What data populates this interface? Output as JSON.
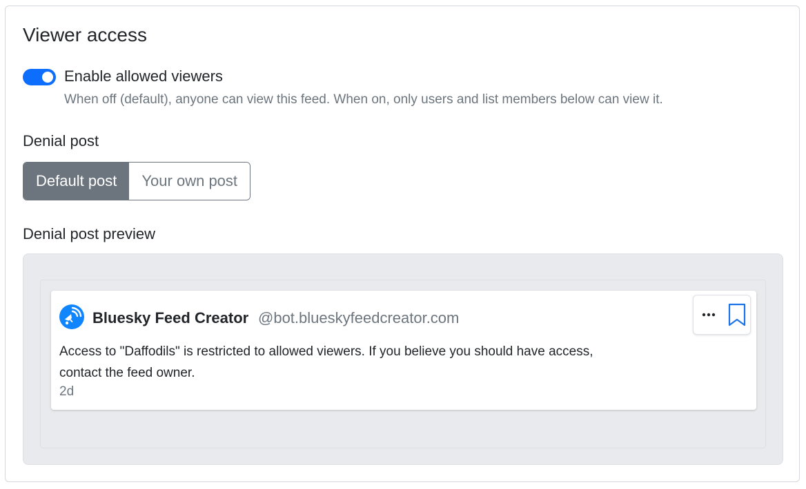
{
  "section": {
    "title": "Viewer access"
  },
  "toggle": {
    "label": "Enable allowed viewers",
    "enabled": true,
    "help": "When off (default), anyone can view this feed. When on, only users and list members below can view it."
  },
  "denial": {
    "label": "Denial post",
    "options": [
      "Default post",
      "Your own post"
    ],
    "selected": "Default post"
  },
  "preview": {
    "label": "Denial post preview",
    "post": {
      "author": "Bluesky Feed Creator",
      "handle": "@bot.blueskyfeedcreator.com",
      "text_line1": "Access to \"Daffodils\" is restricted to allowed viewers. If you believe you should have access,",
      "text_line2": "contact the feed owner.",
      "time": "2d",
      "more_icon": "ellipsis-icon",
      "bookmark_icon": "bookmark-icon",
      "avatar_icon": "satellite-icon"
    }
  },
  "colors": {
    "accent": "#0d6efd",
    "segment_active": "#6c757d",
    "avatar": "#1185fe",
    "preview_bg": "#e9eaed"
  }
}
